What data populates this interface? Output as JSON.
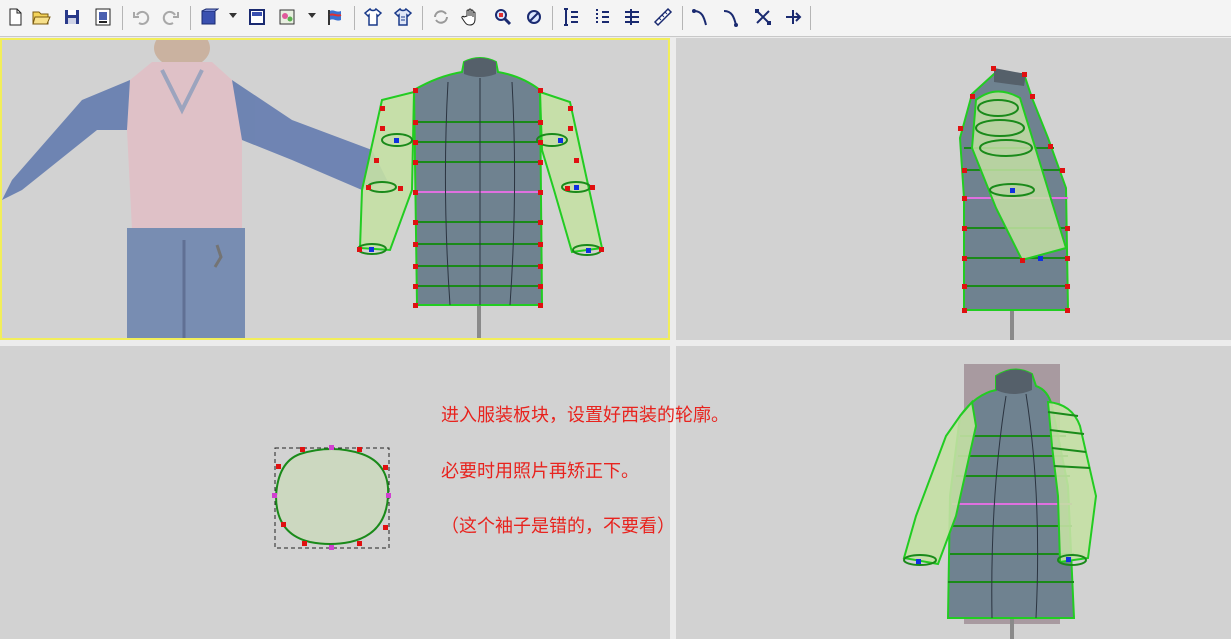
{
  "toolbar": {
    "buttons": [
      {
        "name": "new-file-icon"
      },
      {
        "name": "open-folder-icon"
      },
      {
        "name": "save-icon"
      },
      {
        "name": "print-preview-icon"
      },
      {
        "name": "undo-icon"
      },
      {
        "name": "redo-icon"
      },
      {
        "name": "display-mode-icon"
      },
      {
        "name": "single-view-icon"
      },
      {
        "name": "texture-icon"
      },
      {
        "name": "flag-icon"
      },
      {
        "name": "shirt-icon"
      },
      {
        "name": "shirt-outline-icon"
      },
      {
        "name": "rotate-icon"
      },
      {
        "name": "pan-hand-icon"
      },
      {
        "name": "zoom-window-icon"
      },
      {
        "name": "zoom-fit-icon"
      },
      {
        "name": "vertical-lines-icon"
      },
      {
        "name": "vertical-dashed-lines-icon"
      },
      {
        "name": "vertical-cross-lines-icon"
      },
      {
        "name": "ruler-icon"
      },
      {
        "name": "curve-add-icon"
      },
      {
        "name": "curve-edit-icon"
      },
      {
        "name": "scale-points-icon"
      },
      {
        "name": "move-points-icon"
      }
    ]
  },
  "annotations": {
    "line1": "进入服装板块，设置好西装的轮廓。",
    "line2": "必要时用照片再矫正下。",
    "line3": "（这个袖子是错的，不要看）"
  },
  "colors": {
    "annotation_text": "#e8231e",
    "viewport_bg": "#d2d2d2",
    "active_viewport_border": "#f2ee5a",
    "garment_outline": "#22cc22",
    "control_point": "#e01010",
    "waist_line": "#e070e0"
  }
}
